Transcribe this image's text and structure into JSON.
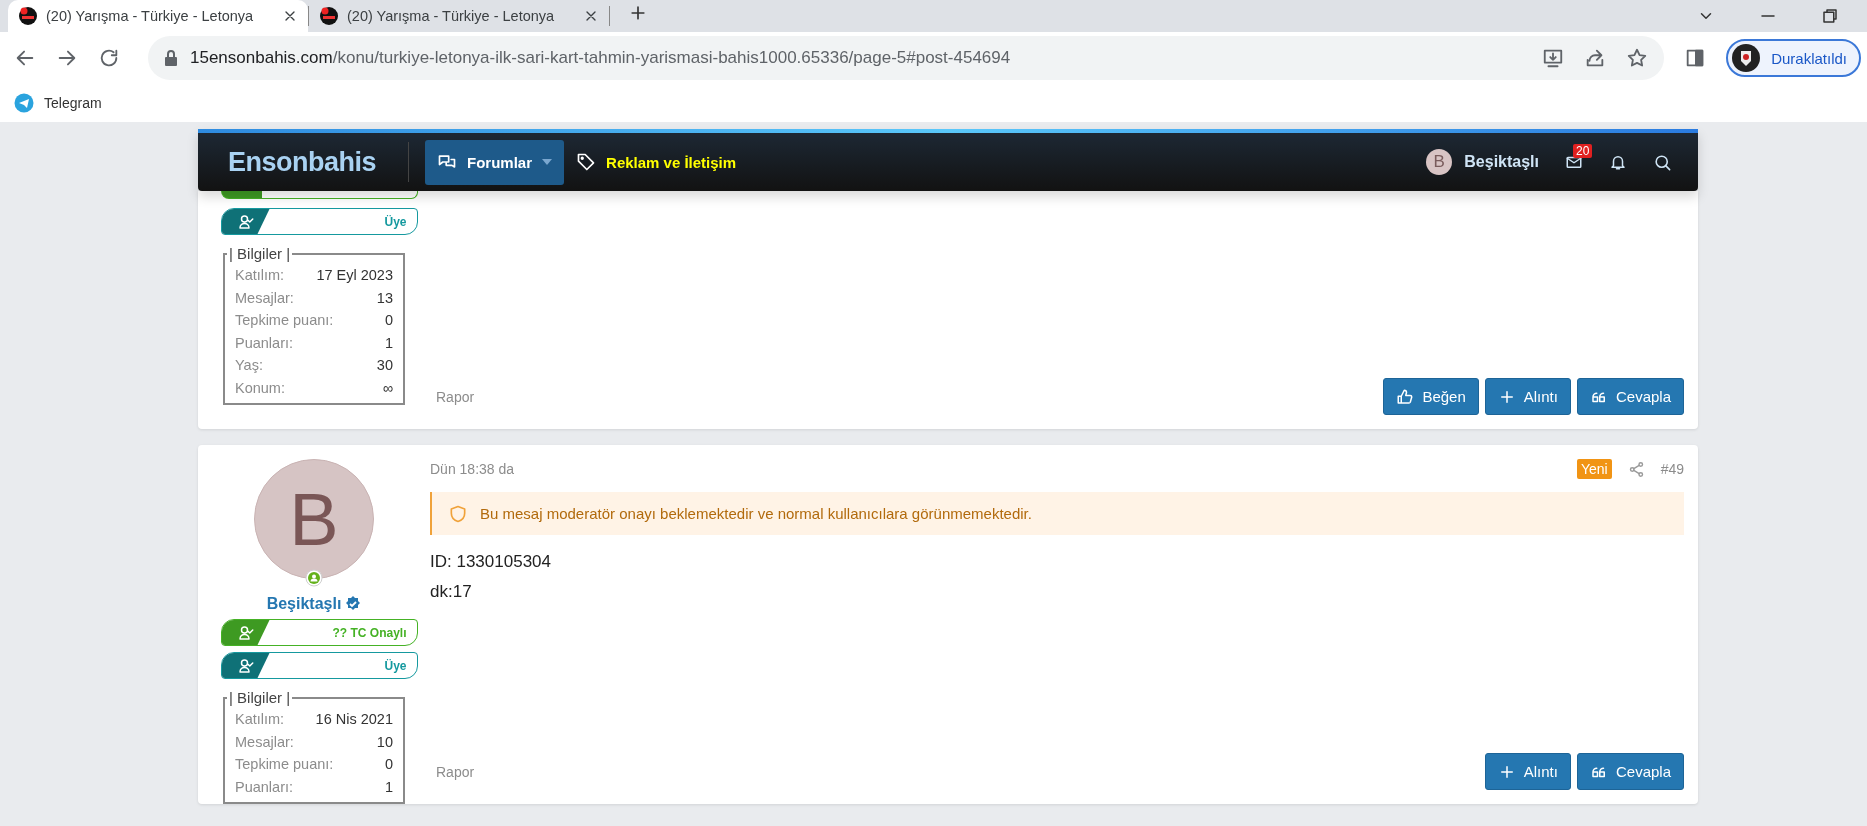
{
  "browser": {
    "tabs": [
      {
        "title": "(20) Yarışma - Türkiye - Letonya",
        "selected": true
      },
      {
        "title": "(20) Yarışma - Türkiye - Letonya",
        "selected": false
      }
    ],
    "url": {
      "domain": "15ensonbahis.com",
      "path": "/konu/turkiye-letonya-ilk-sari-kart-tahmin-yarismasi-bahis1000.65336/page-5#post-454694"
    },
    "profile_button": "Duraklatıldı",
    "bookmarks": [
      "Telegram"
    ]
  },
  "navbar": {
    "logo": "Ensonbahis",
    "items": [
      {
        "label": "Forumlar",
        "selected": true
      },
      {
        "label": "Reklam ve İletişim",
        "selected": false
      }
    ],
    "user": {
      "initial": "B",
      "name": "Beşiktaşlı"
    },
    "inbox_count": "20"
  },
  "posts": [
    {
      "clipped": true,
      "banners": [
        {
          "kind": "member",
          "label": "Üye"
        }
      ],
      "info_title": "| Bilgiler |",
      "info": [
        {
          "label": "Katılım:",
          "value": "17 Eyl 2023"
        },
        {
          "label": "Mesajlar:",
          "value": "13"
        },
        {
          "label": "Tepkime puanı:",
          "value": "0"
        },
        {
          "label": "Puanları:",
          "value": "1"
        },
        {
          "label": "Yaş:",
          "value": "30"
        },
        {
          "label": "Konum:",
          "value": "∞"
        }
      ],
      "report": "Rapor",
      "actions": [
        {
          "kind": "like",
          "label": "Beğen"
        },
        {
          "kind": "quote",
          "label": "Alıntı"
        },
        {
          "kind": "reply",
          "label": "Cevapla"
        }
      ]
    },
    {
      "clipped": false,
      "avatar_initial": "B",
      "online": true,
      "user_name": "Beşiktaşlı",
      "verified": true,
      "banners": [
        {
          "kind": "verified",
          "label": "?? TC Onaylı"
        },
        {
          "kind": "member",
          "label": "Üye"
        }
      ],
      "info_title": "| Bilgiler |",
      "info": [
        {
          "label": "Katılım:",
          "value": "16 Nis 2021"
        },
        {
          "label": "Mesajlar:",
          "value": "10"
        },
        {
          "label": "Tepkime puanı:",
          "value": "0"
        },
        {
          "label": "Puanları:",
          "value": "1"
        }
      ],
      "date": "Dün 18:38 da",
      "new_badge": "Yeni",
      "number": "#49",
      "notice": "Bu mesaj moderatör onayı beklemektedir ve normal kullanıcılara görünmemektedir.",
      "body": [
        "ID: 1330105304",
        "dk:17"
      ],
      "report": "Rapor",
      "actions": [
        {
          "kind": "quote",
          "label": "Alıntı"
        },
        {
          "kind": "reply",
          "label": "Cevapla"
        }
      ]
    }
  ]
}
